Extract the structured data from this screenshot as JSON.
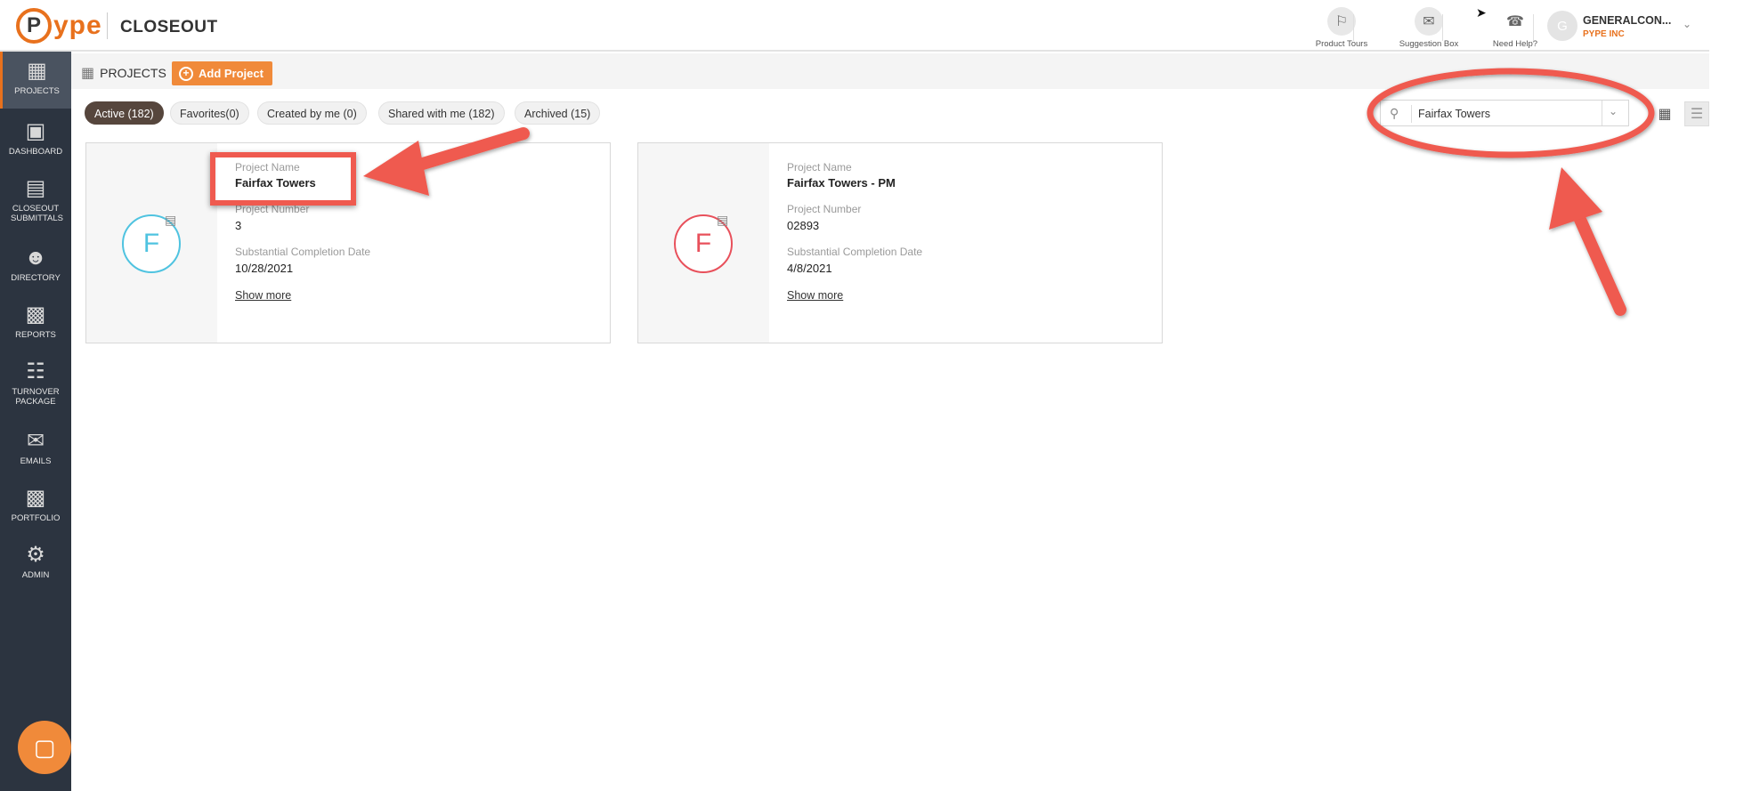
{
  "header": {
    "logo_letter": "P",
    "logo_text": "ype",
    "app_title": "CLOSEOUT",
    "tools": [
      {
        "label": "Product Tours",
        "icon": "signpost-icon"
      },
      {
        "label": "Suggestion Box",
        "icon": "suggestion-box-icon"
      },
      {
        "label": "Need Help?",
        "icon": "phone-help-icon"
      }
    ],
    "user": {
      "initial": "G",
      "name": "GENERALCON...",
      "company": "PYPE INC"
    }
  },
  "sidebar": {
    "items": [
      {
        "label": "PROJECTS",
        "icon": "building-icon",
        "active": true
      },
      {
        "label": "DASHBOARD",
        "icon": "monitor-icon"
      },
      {
        "label": "CLOSEOUT SUBMITTALS",
        "icon": "document-list-icon"
      },
      {
        "label": "DIRECTORY",
        "icon": "people-icon"
      },
      {
        "label": "REPORTS",
        "icon": "report-chart-icon"
      },
      {
        "label": "TURNOVER PACKAGE",
        "icon": "binders-icon"
      },
      {
        "label": "EMAILS",
        "icon": "email-icon"
      },
      {
        "label": "PORTFOLIO",
        "icon": "briefcase-icon"
      },
      {
        "label": "ADMIN",
        "icon": "gear-icon"
      }
    ]
  },
  "toolbar": {
    "projects_label": "PROJECTS",
    "add_project_label": "Add Project"
  },
  "tabs": [
    {
      "label": "Active (182)",
      "active": true
    },
    {
      "label": "Favorites(0)"
    },
    {
      "label": "Created by me (0)"
    },
    {
      "label": "Shared with me (182)"
    },
    {
      "label": "Archived (15)"
    }
  ],
  "search": {
    "value": "Fairfax Towers"
  },
  "cards": [
    {
      "initial": "F",
      "color": "#4fc3e0",
      "name_label": "Project Name",
      "name": "Fairfax Towers",
      "number_label": "Project Number",
      "number": "3",
      "date_label": "Substantial Completion Date",
      "date": "10/28/2021",
      "show_more": "Show more"
    },
    {
      "initial": "F",
      "color": "#e8505b",
      "name_label": "Project Name",
      "name": "Fairfax Towers - PM",
      "number_label": "Project Number",
      "number": "02893",
      "date_label": "Substantial Completion Date",
      "date": "4/8/2021",
      "show_more": "Show more"
    }
  ],
  "colors": {
    "accent": "#e8711d",
    "sidebar": "#2c3440",
    "annotation": "#ef5a4f"
  }
}
